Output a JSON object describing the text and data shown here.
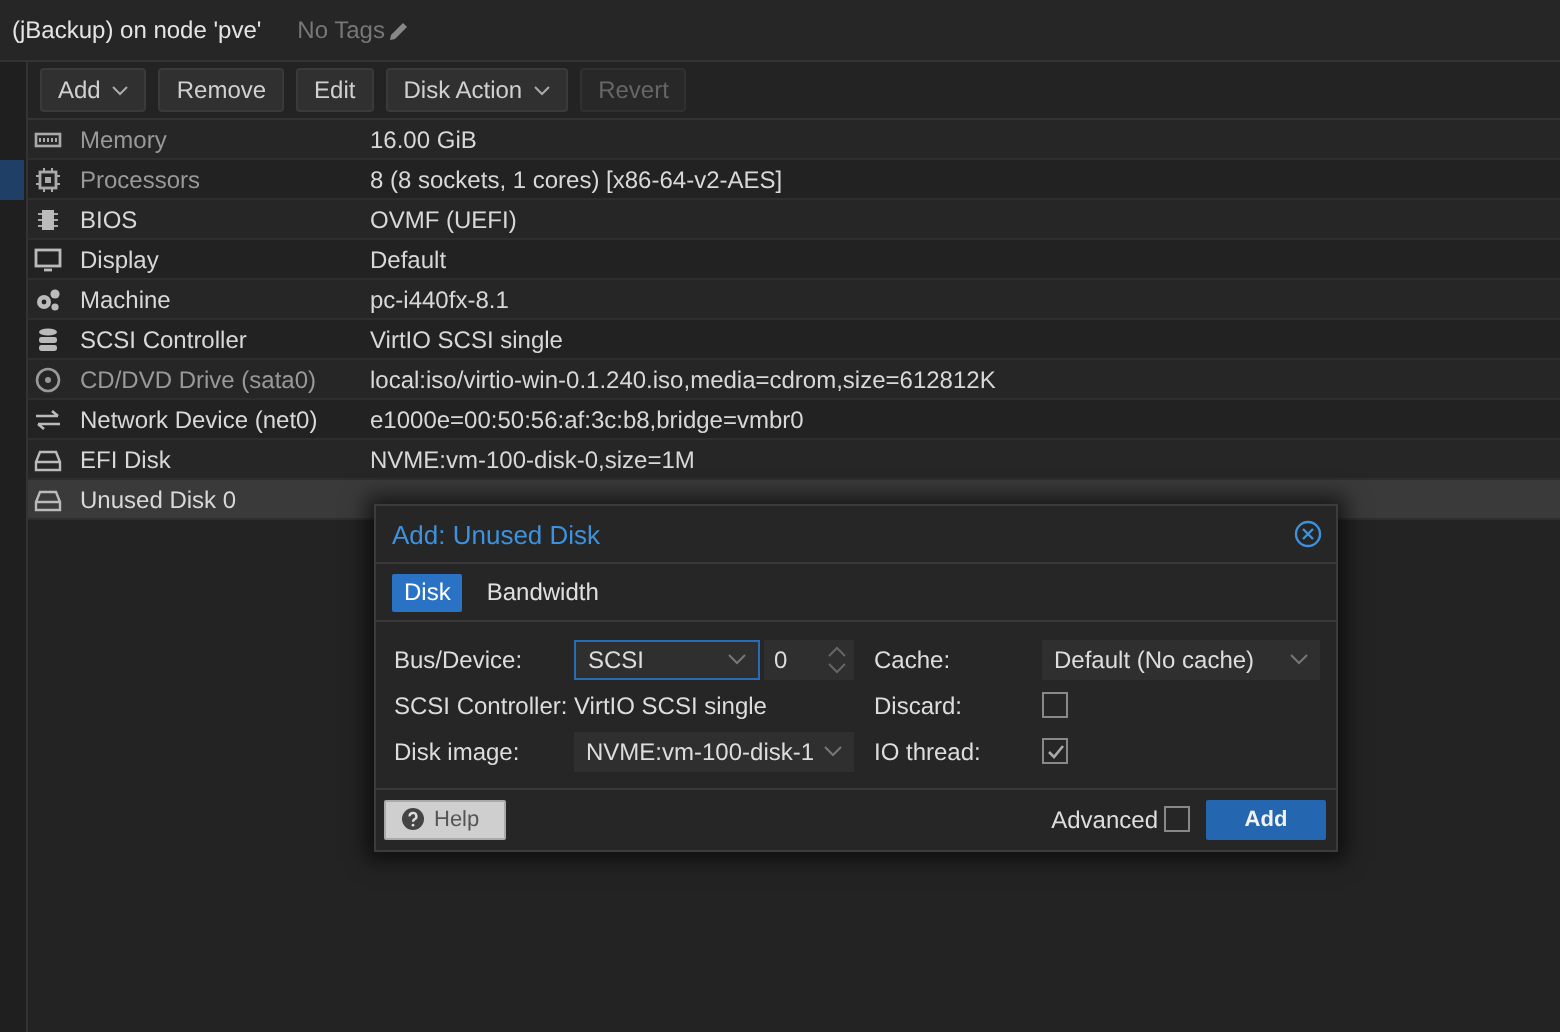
{
  "header": {
    "title": "(jBackup) on node 'pve'",
    "tags": "No Tags"
  },
  "toolbar": {
    "buttons": [
      {
        "label": "Add",
        "dropdown": true,
        "disabled": false
      },
      {
        "label": "Remove",
        "dropdown": false,
        "disabled": false
      },
      {
        "label": "Edit",
        "dropdown": false,
        "disabled": false
      },
      {
        "label": "Disk Action",
        "dropdown": true,
        "disabled": false
      },
      {
        "label": "Revert",
        "dropdown": false,
        "disabled": true
      }
    ]
  },
  "hardware": {
    "rows": [
      {
        "kind": "memory",
        "label": "Memory",
        "value": "16.00 GiB",
        "dimmed": true,
        "selected": false
      },
      {
        "kind": "cpu",
        "label": "Processors",
        "value": "8 (8 sockets, 1 cores) [x86-64-v2-AES]",
        "dimmed": true,
        "selected": false
      },
      {
        "kind": "bios",
        "label": "BIOS",
        "value": "OVMF (UEFI)",
        "dimmed": false,
        "selected": false
      },
      {
        "kind": "display",
        "label": "Display",
        "value": "Default",
        "dimmed": false,
        "selected": false
      },
      {
        "kind": "machine",
        "label": "Machine",
        "value": "pc-i440fx-8.1",
        "dimmed": false,
        "selected": false
      },
      {
        "kind": "storage",
        "label": "SCSI Controller",
        "value": "VirtIO SCSI single",
        "dimmed": false,
        "selected": false
      },
      {
        "kind": "cdrom",
        "label": "CD/DVD Drive (sata0)",
        "value": "local:iso/virtio-win-0.1.240.iso,media=cdrom,size=612812K",
        "dimmed": true,
        "selected": false
      },
      {
        "kind": "network",
        "label": "Network Device (net0)",
        "value": "e1000e=00:50:56:af:3c:b8,bridge=vmbr0",
        "dimmed": false,
        "selected": false
      },
      {
        "kind": "disk",
        "label": "EFI Disk",
        "value": "NVME:vm-100-disk-0,size=1M",
        "dimmed": false,
        "selected": false
      },
      {
        "kind": "disk",
        "label": "Unused Disk 0",
        "dimmed": false,
        "selected": true
      }
    ]
  },
  "dialog": {
    "title": "Add: Unused Disk",
    "tabs": [
      {
        "label": "Disk",
        "selected": true
      },
      {
        "label": "Bandwidth",
        "selected": false
      }
    ],
    "left": [
      {
        "kind": "bus",
        "label": "Bus/Device:",
        "value": "SCSI",
        "number": "0"
      },
      {
        "kind": "display",
        "label": "SCSI Controller:",
        "value": "VirtIO SCSI single"
      },
      {
        "kind": "select",
        "label": "Disk image:",
        "value": "NVME:vm-100-disk-1"
      }
    ],
    "right": [
      {
        "kind": "select",
        "label": "Cache:",
        "value": "Default (No cache)"
      },
      {
        "kind": "checkbox",
        "label": "Discard:",
        "checked": false
      },
      {
        "kind": "checkbox",
        "label": "IO thread:",
        "checked": true
      }
    ],
    "help": "Help",
    "advanced": {
      "label": "Advanced",
      "checked": false
    },
    "submit": "Add"
  }
}
